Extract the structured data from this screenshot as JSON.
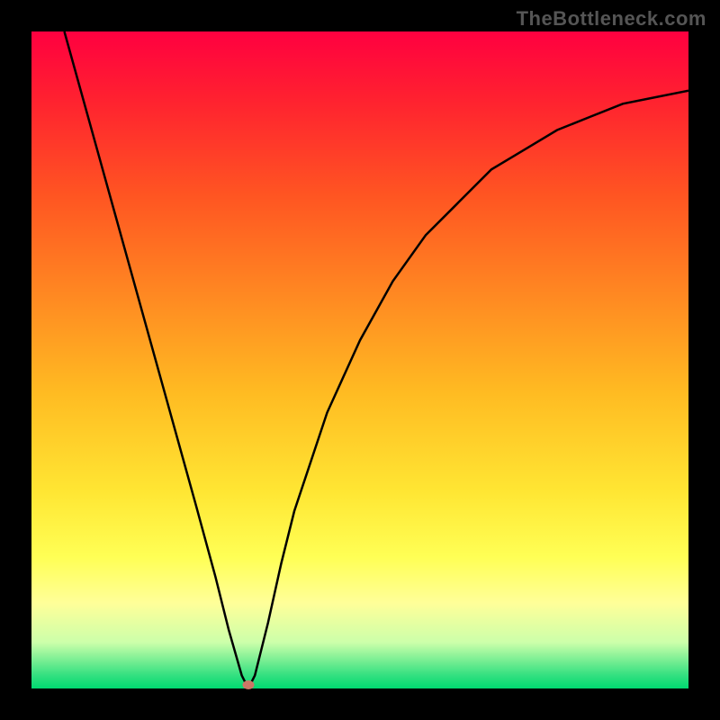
{
  "watermark": "TheBottleneck.com",
  "marker": {
    "x_fraction": 0.33,
    "y_fraction": 0.995
  },
  "chart_data": {
    "type": "line",
    "title": "",
    "xlabel": "",
    "ylabel": "",
    "xlim": [
      0,
      100
    ],
    "ylim": [
      0,
      100
    ],
    "x": [
      5,
      10,
      15,
      20,
      25,
      28,
      30,
      32,
      33,
      34,
      36,
      38,
      40,
      45,
      50,
      55,
      60,
      65,
      70,
      75,
      80,
      85,
      90,
      95,
      100
    ],
    "values": [
      100,
      82,
      64,
      46,
      28,
      17,
      9,
      2,
      0,
      2,
      10,
      19,
      27,
      42,
      53,
      62,
      69,
      74,
      79,
      82,
      85,
      87,
      89,
      90,
      91
    ],
    "minimum_point": {
      "x": 33,
      "y": 0
    },
    "background_gradient": {
      "top": "#ff0040",
      "bottom": "#00d870",
      "stops": [
        "red",
        "orange",
        "yellow",
        "green"
      ]
    },
    "annotations": [
      {
        "type": "marker",
        "x": 33,
        "y": 0.5,
        "color": "#cc7766"
      }
    ]
  }
}
